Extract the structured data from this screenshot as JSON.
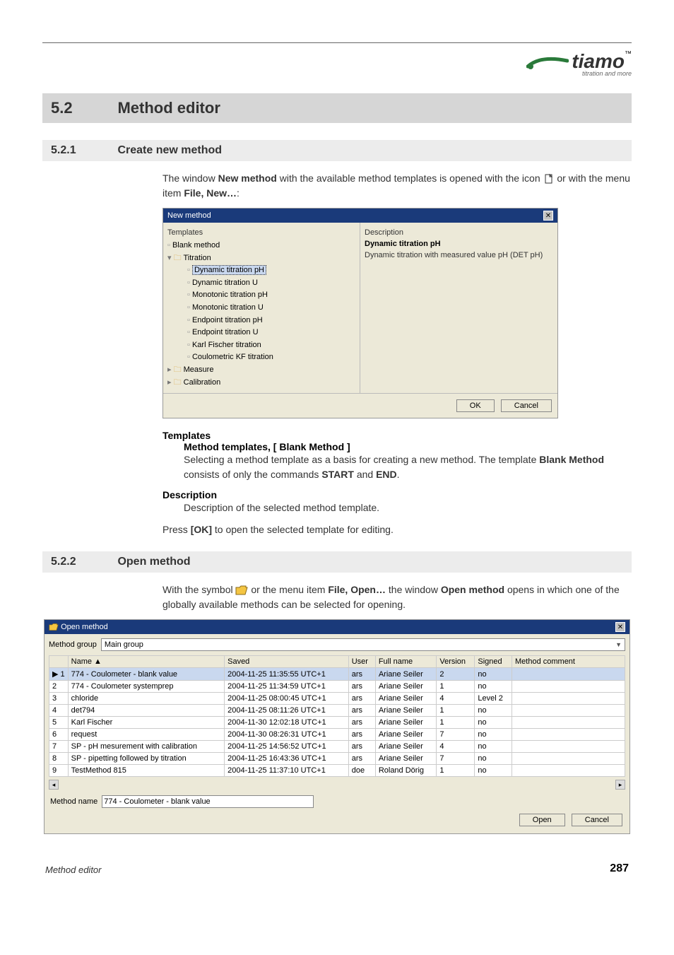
{
  "logo": {
    "text": "tiamo",
    "tm": "™",
    "sub": "titration and more"
  },
  "section": {
    "num": "5.2",
    "label": "Method editor"
  },
  "sub1": {
    "num": "5.2.1",
    "label": "Create new method",
    "intro_a": "The window ",
    "intro_bold1": "New method",
    "intro_b": " with the available method templates is opened with the icon ",
    "intro_c": " or with the menu item ",
    "intro_bold2": "File, New…",
    "intro_d": ":"
  },
  "dlg_new": {
    "title": "New method",
    "col_left": "Templates",
    "col_right": "Description",
    "tree": {
      "blank": "Blank method",
      "titration": "Titration",
      "items": [
        "Dynamic titration pH",
        "Dynamic titration U",
        "Monotonic titration pH",
        "Monotonic titration U",
        "Endpoint titration pH",
        "Endpoint titration U",
        "Karl Fischer titration",
        "Coulometric KF titration"
      ],
      "measure": "Measure",
      "calibration": "Calibration"
    },
    "desc_title": "Dynamic titration pH",
    "desc_body": "Dynamic titration with measured value pH (DET pH)",
    "ok": "OK",
    "cancel": "Cancel"
  },
  "defs": {
    "templates": "Templates",
    "templates_sub": "Method templates, [ Blank Method ]",
    "templates_body_a": "Selecting a method template as a basis for creating a new method. The template ",
    "templates_body_bold1": "Blank Method",
    "templates_body_b": " consists of only the commands ",
    "templates_body_bold2": "START",
    "templates_body_c": " and ",
    "templates_body_bold3": "END",
    "templates_body_d": ".",
    "description": "Description",
    "description_body": "Description of the selected method template.",
    "press_a": "Press ",
    "press_bold": "[OK]",
    "press_b": " to open the selected template for editing."
  },
  "sub2": {
    "num": "5.2.2",
    "label": "Open method",
    "intro_a": "With the symbol ",
    "intro_b": " or the menu item ",
    "intro_bold1": "File, Open…",
    "intro_c": " the window ",
    "intro_bold2": "Open method",
    "intro_d": " opens in which one of the globally available methods can be selected for opening."
  },
  "dlg_open": {
    "title": "Open method",
    "group_label": "Method group",
    "group_value": "Main group",
    "cols": [
      "",
      "Name ▲",
      "Saved",
      "User",
      "Full name",
      "Version",
      "Signed",
      "Method comment"
    ],
    "rows": [
      {
        "n": "1",
        "name": "774 - Coulometer - blank value",
        "saved": "2004-11-25 11:35:55 UTC+1",
        "user": "ars",
        "full": "Ariane Seiler",
        "ver": "2",
        "signed": "no",
        "comment": ""
      },
      {
        "n": "2",
        "name": "774 - Coulometer systemprep",
        "saved": "2004-11-25 11:34:59 UTC+1",
        "user": "ars",
        "full": "Ariane Seiler",
        "ver": "1",
        "signed": "no",
        "comment": ""
      },
      {
        "n": "3",
        "name": "chloride",
        "saved": "2004-11-25 08:00:45 UTC+1",
        "user": "ars",
        "full": "Ariane Seiler",
        "ver": "4",
        "signed": "Level 2",
        "comment": ""
      },
      {
        "n": "4",
        "name": "det794",
        "saved": "2004-11-25 08:11:26 UTC+1",
        "user": "ars",
        "full": "Ariane Seiler",
        "ver": "1",
        "signed": "no",
        "comment": ""
      },
      {
        "n": "5",
        "name": "Karl Fischer",
        "saved": "2004-11-30 12:02:18 UTC+1",
        "user": "ars",
        "full": "Ariane Seiler",
        "ver": "1",
        "signed": "no",
        "comment": ""
      },
      {
        "n": "6",
        "name": "request",
        "saved": "2004-11-30 08:26:31 UTC+1",
        "user": "ars",
        "full": "Ariane Seiler",
        "ver": "7",
        "signed": "no",
        "comment": ""
      },
      {
        "n": "7",
        "name": "SP - pH mesurement with calibration",
        "saved": "2004-11-25 14:56:52 UTC+1",
        "user": "ars",
        "full": "Ariane Seiler",
        "ver": "4",
        "signed": "no",
        "comment": ""
      },
      {
        "n": "8",
        "name": "SP - pipetting followed by titration",
        "saved": "2004-11-25 16:43:36 UTC+1",
        "user": "ars",
        "full": "Ariane Seiler",
        "ver": "7",
        "signed": "no",
        "comment": ""
      },
      {
        "n": "9",
        "name": "TestMethod 815",
        "saved": "2004-11-25 11:37:10 UTC+1",
        "user": "doe",
        "full": "Roland Dörig",
        "ver": "1",
        "signed": "no",
        "comment": ""
      }
    ],
    "name_label": "Method name",
    "name_value": "774 - Coulometer - blank value",
    "open": "Open",
    "cancel": "Cancel"
  },
  "footer": {
    "left": "Method editor",
    "right": "287"
  }
}
